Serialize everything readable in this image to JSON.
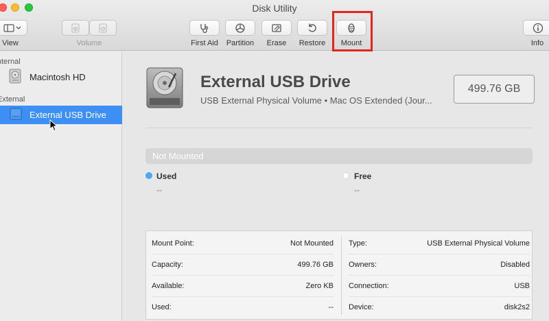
{
  "window": {
    "title": "Disk Utility"
  },
  "toolbar": {
    "view_label": "View",
    "volume_label": "Volume",
    "first_aid_label": "First Aid",
    "partition_label": "Partition",
    "erase_label": "Erase",
    "restore_label": "Restore",
    "mount_label": "Mount",
    "info_label": "Info"
  },
  "sidebar": {
    "internal_label": "nternal",
    "external_label": "External",
    "items": [
      {
        "label": "Macintosh HD",
        "icon": "internal-disk-icon"
      },
      {
        "label": "External USB Drive",
        "icon": "external-disk-icon",
        "selected": true
      }
    ]
  },
  "disk": {
    "name": "External USB Drive",
    "subtitle": "USB External Physical Volume • Mac OS Extended (Jour...",
    "size": "499.76 GB",
    "status_bar": "Not Mounted",
    "used_label": "Used",
    "used_value": "--",
    "free_label": "Free",
    "free_value": "--"
  },
  "info": {
    "left": [
      {
        "key": "Mount Point:",
        "value": "Not Mounted"
      },
      {
        "key": "Capacity:",
        "value": "499.76 GB"
      },
      {
        "key": "Available:",
        "value": "Zero KB"
      },
      {
        "key": "Used:",
        "value": "--"
      }
    ],
    "right": [
      {
        "key": "Type:",
        "value": "USB External Physical Volume"
      },
      {
        "key": "Owners:",
        "value": "Disabled"
      },
      {
        "key": "Connection:",
        "value": "USB"
      },
      {
        "key": "Device:",
        "value": "disk2s2"
      }
    ]
  },
  "colors": {
    "accent": "#3d8ff5",
    "used_dot": "#4ea9ef",
    "free_dot": "#ffffff",
    "highlight": "#e0261f"
  }
}
